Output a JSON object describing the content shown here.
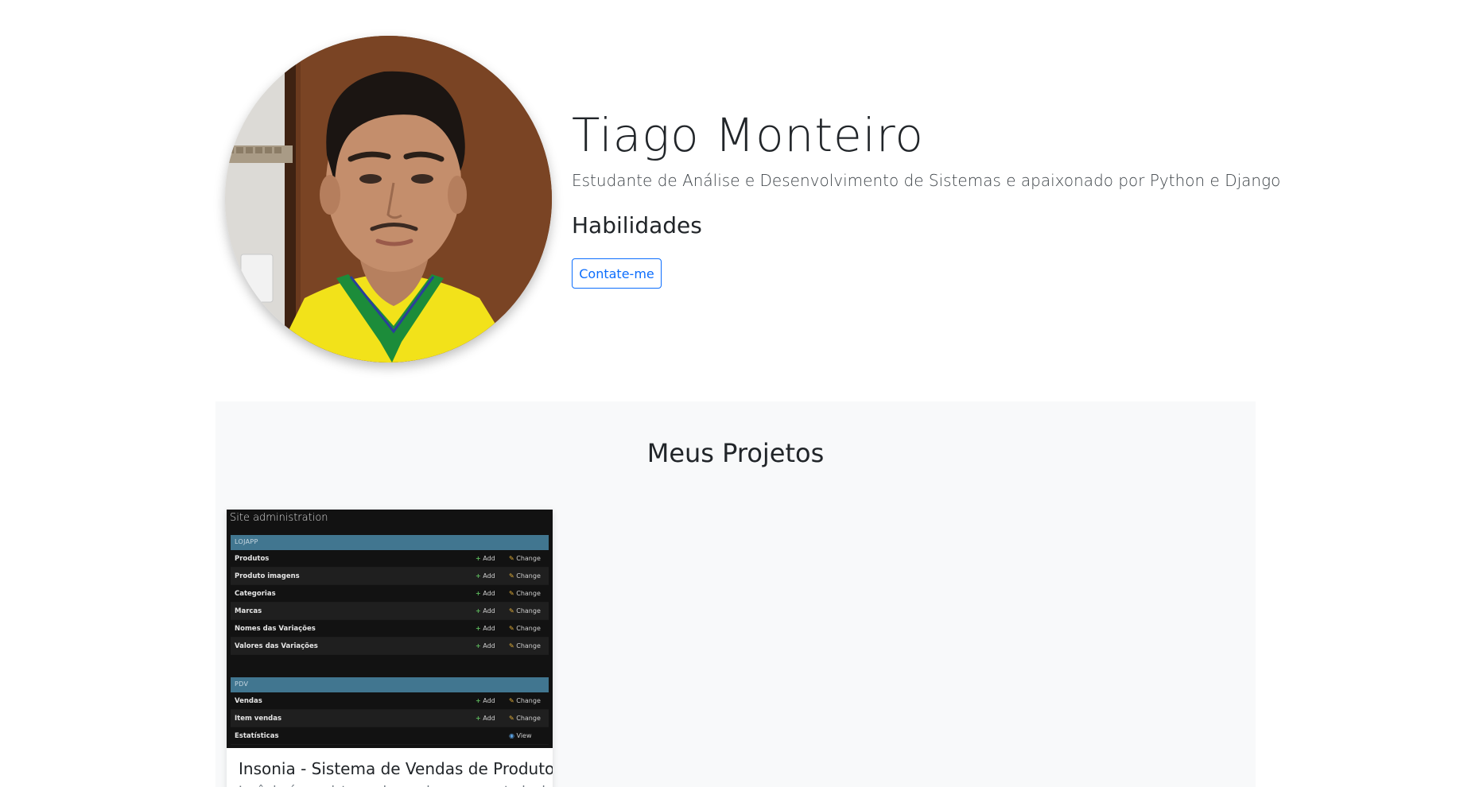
{
  "profile": {
    "name": "Tiago Monteiro",
    "bio": "Estudante de Análise e Desenvolvimento de Sistemas e apaixonado por Python e Django",
    "skills_heading": "Habilidades",
    "contact_button": "Contate-me"
  },
  "projects": {
    "heading": "Meus Projetos",
    "cards": [
      {
        "title": "Insonia - Sistema de Vendas de Produtos",
        "text": "Insônia é um sistema de vendas para controle de produtos",
        "screenshot": {
          "header": "Site administration",
          "add_label": "Add",
          "change_label": "Change",
          "view_label": "View",
          "groups": [
            {
              "caption": "LOJAPP",
              "rows": [
                "Produtos",
                "Produto imagens",
                "Categorias",
                "Marcas",
                "Nomes das Variações",
                "Valores das Variações"
              ]
            },
            {
              "caption": "PDV",
              "rows": [
                "Vendas",
                "Item vendas",
                "Estatísticas"
              ]
            }
          ]
        }
      }
    ]
  },
  "colors": {
    "primary": "#0d6efd",
    "section_bg": "#f8f9fa",
    "admin_caption": "#417690",
    "admin_bg": "#121212"
  }
}
